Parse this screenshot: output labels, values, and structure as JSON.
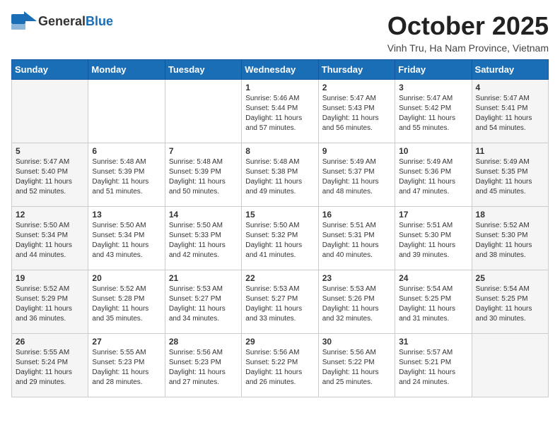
{
  "header": {
    "logo_general": "General",
    "logo_blue": "Blue",
    "month": "October 2025",
    "location": "Vinh Tru, Ha Nam Province, Vietnam"
  },
  "weekdays": [
    "Sunday",
    "Monday",
    "Tuesday",
    "Wednesday",
    "Thursday",
    "Friday",
    "Saturday"
  ],
  "weeks": [
    [
      {
        "day": "",
        "info": ""
      },
      {
        "day": "",
        "info": ""
      },
      {
        "day": "",
        "info": ""
      },
      {
        "day": "1",
        "info": "Sunrise: 5:46 AM\nSunset: 5:44 PM\nDaylight: 11 hours\nand 57 minutes."
      },
      {
        "day": "2",
        "info": "Sunrise: 5:47 AM\nSunset: 5:43 PM\nDaylight: 11 hours\nand 56 minutes."
      },
      {
        "day": "3",
        "info": "Sunrise: 5:47 AM\nSunset: 5:42 PM\nDaylight: 11 hours\nand 55 minutes."
      },
      {
        "day": "4",
        "info": "Sunrise: 5:47 AM\nSunset: 5:41 PM\nDaylight: 11 hours\nand 54 minutes."
      }
    ],
    [
      {
        "day": "5",
        "info": "Sunrise: 5:47 AM\nSunset: 5:40 PM\nDaylight: 11 hours\nand 52 minutes."
      },
      {
        "day": "6",
        "info": "Sunrise: 5:48 AM\nSunset: 5:39 PM\nDaylight: 11 hours\nand 51 minutes."
      },
      {
        "day": "7",
        "info": "Sunrise: 5:48 AM\nSunset: 5:39 PM\nDaylight: 11 hours\nand 50 minutes."
      },
      {
        "day": "8",
        "info": "Sunrise: 5:48 AM\nSunset: 5:38 PM\nDaylight: 11 hours\nand 49 minutes."
      },
      {
        "day": "9",
        "info": "Sunrise: 5:49 AM\nSunset: 5:37 PM\nDaylight: 11 hours\nand 48 minutes."
      },
      {
        "day": "10",
        "info": "Sunrise: 5:49 AM\nSunset: 5:36 PM\nDaylight: 11 hours\nand 47 minutes."
      },
      {
        "day": "11",
        "info": "Sunrise: 5:49 AM\nSunset: 5:35 PM\nDaylight: 11 hours\nand 45 minutes."
      }
    ],
    [
      {
        "day": "12",
        "info": "Sunrise: 5:50 AM\nSunset: 5:34 PM\nDaylight: 11 hours\nand 44 minutes."
      },
      {
        "day": "13",
        "info": "Sunrise: 5:50 AM\nSunset: 5:34 PM\nDaylight: 11 hours\nand 43 minutes."
      },
      {
        "day": "14",
        "info": "Sunrise: 5:50 AM\nSunset: 5:33 PM\nDaylight: 11 hours\nand 42 minutes."
      },
      {
        "day": "15",
        "info": "Sunrise: 5:50 AM\nSunset: 5:32 PM\nDaylight: 11 hours\nand 41 minutes."
      },
      {
        "day": "16",
        "info": "Sunrise: 5:51 AM\nSunset: 5:31 PM\nDaylight: 11 hours\nand 40 minutes."
      },
      {
        "day": "17",
        "info": "Sunrise: 5:51 AM\nSunset: 5:30 PM\nDaylight: 11 hours\nand 39 minutes."
      },
      {
        "day": "18",
        "info": "Sunrise: 5:52 AM\nSunset: 5:30 PM\nDaylight: 11 hours\nand 38 minutes."
      }
    ],
    [
      {
        "day": "19",
        "info": "Sunrise: 5:52 AM\nSunset: 5:29 PM\nDaylight: 11 hours\nand 36 minutes."
      },
      {
        "day": "20",
        "info": "Sunrise: 5:52 AM\nSunset: 5:28 PM\nDaylight: 11 hours\nand 35 minutes."
      },
      {
        "day": "21",
        "info": "Sunrise: 5:53 AM\nSunset: 5:27 PM\nDaylight: 11 hours\nand 34 minutes."
      },
      {
        "day": "22",
        "info": "Sunrise: 5:53 AM\nSunset: 5:27 PM\nDaylight: 11 hours\nand 33 minutes."
      },
      {
        "day": "23",
        "info": "Sunrise: 5:53 AM\nSunset: 5:26 PM\nDaylight: 11 hours\nand 32 minutes."
      },
      {
        "day": "24",
        "info": "Sunrise: 5:54 AM\nSunset: 5:25 PM\nDaylight: 11 hours\nand 31 minutes."
      },
      {
        "day": "25",
        "info": "Sunrise: 5:54 AM\nSunset: 5:25 PM\nDaylight: 11 hours\nand 30 minutes."
      }
    ],
    [
      {
        "day": "26",
        "info": "Sunrise: 5:55 AM\nSunset: 5:24 PM\nDaylight: 11 hours\nand 29 minutes."
      },
      {
        "day": "27",
        "info": "Sunrise: 5:55 AM\nSunset: 5:23 PM\nDaylight: 11 hours\nand 28 minutes."
      },
      {
        "day": "28",
        "info": "Sunrise: 5:56 AM\nSunset: 5:23 PM\nDaylight: 11 hours\nand 27 minutes."
      },
      {
        "day": "29",
        "info": "Sunrise: 5:56 AM\nSunset: 5:22 PM\nDaylight: 11 hours\nand 26 minutes."
      },
      {
        "day": "30",
        "info": "Sunrise: 5:56 AM\nSunset: 5:22 PM\nDaylight: 11 hours\nand 25 minutes."
      },
      {
        "day": "31",
        "info": "Sunrise: 5:57 AM\nSunset: 5:21 PM\nDaylight: 11 hours\nand 24 minutes."
      },
      {
        "day": "",
        "info": ""
      }
    ]
  ]
}
